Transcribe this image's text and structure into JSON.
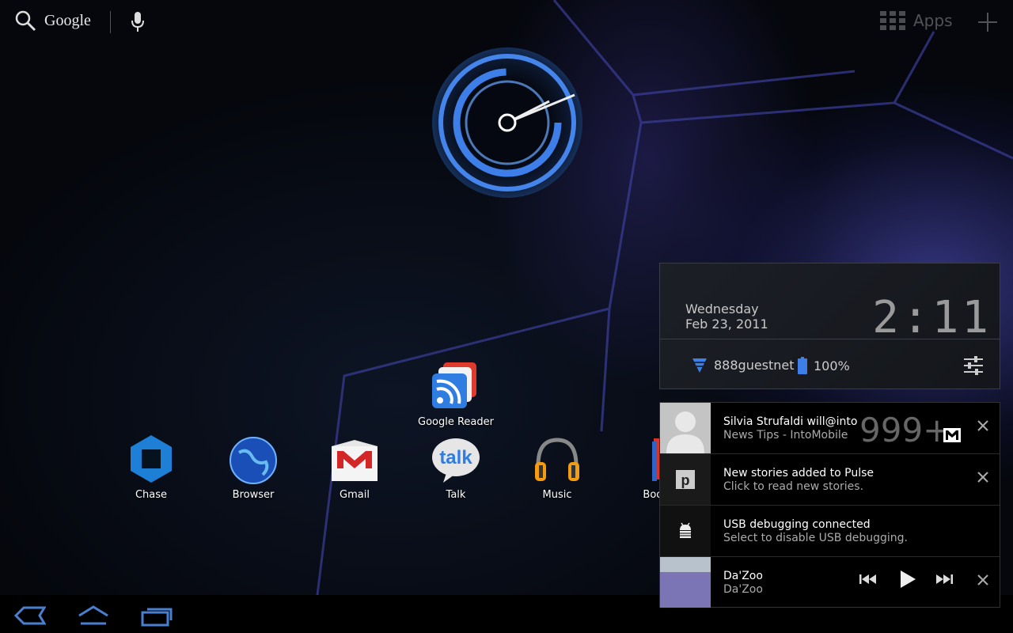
{
  "search": {
    "label": "Google"
  },
  "topbar": {
    "apps_label": "Apps"
  },
  "apps": [
    {
      "label": "Google Reader"
    },
    {
      "label": "Chase"
    },
    {
      "label": "Browser"
    },
    {
      "label": "Gmail"
    },
    {
      "label": "Talk"
    },
    {
      "label": "Music"
    },
    {
      "label": "Books"
    }
  ],
  "status_card": {
    "day": "Wednesday",
    "date": "Feb 23, 2011",
    "time": "2:11",
    "wifi_name": "888guestnet",
    "battery": "100%"
  },
  "notifications": [
    {
      "title": "Silvia Strufaldi   will@into",
      "subtitle": "News Tips - IntoMobile",
      "count": "999+"
    },
    {
      "title": "New stories added to Pulse",
      "subtitle": "Click to read new stories."
    },
    {
      "title": "USB debugging connected",
      "subtitle": "Select to disable USB debugging."
    },
    {
      "title": "Da'Zoo",
      "subtitle": "Da'Zoo"
    }
  ],
  "colors": {
    "accent": "#3d8bff",
    "clock_blue": "#4a90ff"
  }
}
